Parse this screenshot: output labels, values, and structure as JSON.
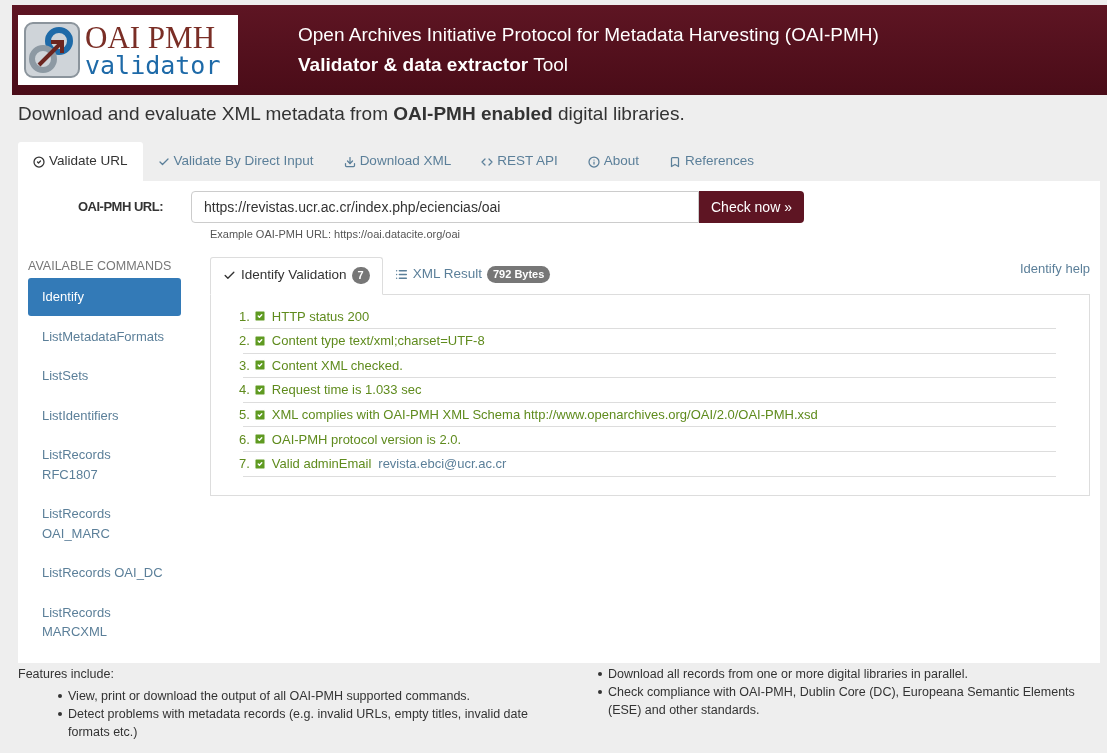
{
  "header": {
    "logo_line_1": "OAI PMH",
    "logo_line_2": "validator",
    "title": "Open Archives Initiative Protocol for Metadata Harvesting (OAI-PMH)",
    "subtitle": "**Validator & data extractor** Tool"
  },
  "intro": "Download and evaluate XML metadata from **OAI-PMH enabled** digital libraries.",
  "tabs": [
    {
      "label": "Validate URL",
      "kind": "circle-check",
      "selected": true
    },
    {
      "label": "Validate By Direct Input",
      "kind": "check",
      "selected": false
    },
    {
      "label": "Download XML",
      "kind": "download",
      "selected": false
    },
    {
      "label": "REST API",
      "kind": "code",
      "selected": false
    },
    {
      "label": "About",
      "kind": "info",
      "selected": false
    },
    {
      "label": "References",
      "kind": "bookmark",
      "selected": false
    }
  ],
  "url_form": {
    "label": "OAI-PMH URL:",
    "value": "https://revistas.ucr.ac.cr/index.php/eciencias/oai",
    "button": "Check now »",
    "hint": "Example OAI-PMH URL: https://oai.datacite.org/oai"
  },
  "sidebar": {
    "heading": "AVAILABLE COMMANDS",
    "items": [
      {
        "label": "Identify",
        "selected": true
      },
      {
        "label": "ListMetadataFormats",
        "selected": false
      },
      {
        "label": "ListSets",
        "selected": false
      },
      {
        "label": "ListIdentifiers",
        "selected": false
      },
      {
        "label": "ListRecords\nRFC1807",
        "selected": false
      },
      {
        "label": "ListRecords\nOAI_MARC",
        "selected": false
      },
      {
        "label": "ListRecords OAI_DC",
        "selected": false
      },
      {
        "label": "ListRecords\nMARCXML",
        "selected": false
      }
    ]
  },
  "result_tabs": [
    {
      "label": "Identify Validation",
      "kind": "check",
      "badge": "7",
      "selected": true
    },
    {
      "label": "XML Result",
      "kind": "list",
      "badge": "792 Bytes",
      "selected": false
    }
  ],
  "help_link": "Identify help",
  "checks": [
    {
      "number": "1.",
      "text": "HTTP status 200",
      "checked": true
    },
    {
      "number": "2.",
      "text": "Content type text/xml;charset=UTF-8",
      "checked": true
    },
    {
      "number": "3.",
      "text": "Content XML checked.",
      "checked": true
    },
    {
      "number": "4.",
      "text": "Request time is 1.033 sec",
      "checked": true
    },
    {
      "number": "5.",
      "text": "XML complies with OAI-PMH XML Schema http://www.openarchives.org/OAI/2.0/OAI-PMH.xsd",
      "checked": true
    },
    {
      "number": "6.",
      "text": "OAI-PMH protocol version is 2.0.",
      "checked": true
    },
    {
      "number": "7.",
      "text": "Valid adminEmail",
      "link": "revista.ebci@ucr.ac.cr",
      "checked": true
    }
  ],
  "features": {
    "heading": "Features include:",
    "left": [
      "View, print or download the output of all OAI-PMH supported commands.",
      "Detect problems with metadata records (e.g. invalid URLs, empty titles, invalid date formats etc.)"
    ],
    "right": [
      "Download all records from one or more digital libraries in parallel.",
      "Check compliance with OAI-PMH, Dublin Core (DC), Europeana Semantic Elements (ESE) and other standards."
    ]
  }
}
